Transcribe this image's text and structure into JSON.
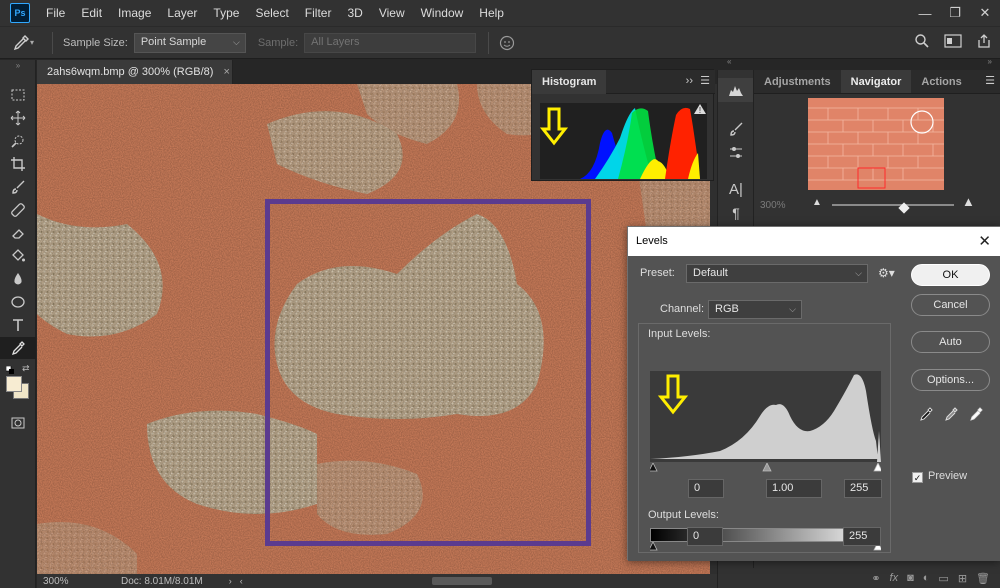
{
  "app": {
    "logo": "Ps"
  },
  "menu": [
    "File",
    "Edit",
    "Image",
    "Layer",
    "Type",
    "Select",
    "Filter",
    "3D",
    "View",
    "Window",
    "Help"
  ],
  "window_controls": [
    "—",
    "❐",
    "✕"
  ],
  "options": {
    "sample_size_label": "Sample Size:",
    "sample_size_value": "Point Sample",
    "sample_label": "Sample:",
    "sample_value": "All Layers"
  },
  "document": {
    "tab_title": "2ahs6wqm.bmp @ 300% (RGB/8)",
    "tab_close": "×",
    "zoom": "300%",
    "doc_size": "Doc: 8.01M/8.01M"
  },
  "histogram_panel": {
    "title": "Histogram",
    "menu": "››"
  },
  "right_panel": {
    "tabs": [
      "Adjustments",
      "Navigator",
      "Actions"
    ],
    "active_tab": "Navigator",
    "nav_zoom": "300%"
  },
  "levels": {
    "title": "Levels",
    "close": "✕",
    "preset_label": "Preset:",
    "preset_value": "Default",
    "channel_label": "Channel:",
    "channel_value": "RGB",
    "input_levels_label": "Input Levels:",
    "input_black": "0",
    "input_gamma": "1.00",
    "input_white": "255",
    "output_levels_label": "Output Levels:",
    "output_black": "0",
    "output_white": "255",
    "buttons": {
      "ok": "OK",
      "cancel": "Cancel",
      "auto": "Auto",
      "options": "Options..."
    },
    "preview_label": "Preview",
    "preview_checked": true
  },
  "colors": {
    "accent_purple": "#5b3b8f",
    "annotation_yellow": "#ffee00",
    "canvas_orange": "#d98560"
  }
}
